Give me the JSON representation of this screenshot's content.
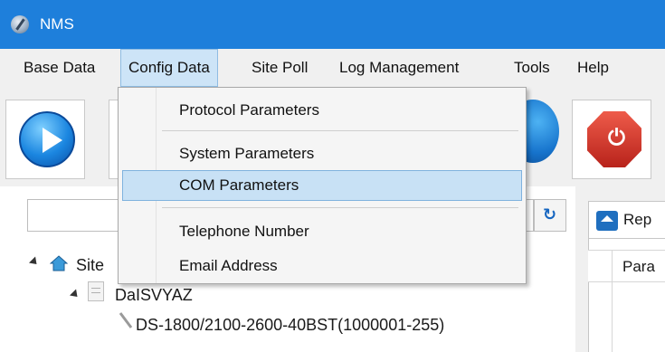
{
  "window": {
    "title": "NMS"
  },
  "menubar": {
    "items": [
      {
        "label": "Base Data",
        "active": false
      },
      {
        "label": "Config Data",
        "active": true
      },
      {
        "label": "Site Poll",
        "active": false
      },
      {
        "label": "Log Management",
        "active": false
      },
      {
        "label": "Tools",
        "active": false
      },
      {
        "label": "Help",
        "active": false
      }
    ]
  },
  "toolbar": {
    "icons": [
      "play-icon",
      "power-icon"
    ],
    "power_glyph": "⏻"
  },
  "config_menu": {
    "items": [
      {
        "label": "Protocol Parameters",
        "highlighted": false
      },
      {
        "label": "System Parameters",
        "highlighted": false
      },
      {
        "label": "COM Parameters",
        "highlighted": true
      },
      {
        "label": "Telephone Number",
        "highlighted": false
      },
      {
        "label": "Email Address",
        "highlighted": false
      }
    ]
  },
  "left_panel": {
    "search": {
      "value": "",
      "placeholder": ""
    },
    "refresh_glyph": "↻",
    "tree": {
      "root": {
        "label": "Site"
      },
      "site": {
        "label": "DaISVYAZ"
      },
      "device": {
        "label": "DS-1800/2100-2600-40BST(1000001-255)"
      }
    }
  },
  "right_panel": {
    "tab_label": "Rep",
    "grid_header": "Para"
  }
}
